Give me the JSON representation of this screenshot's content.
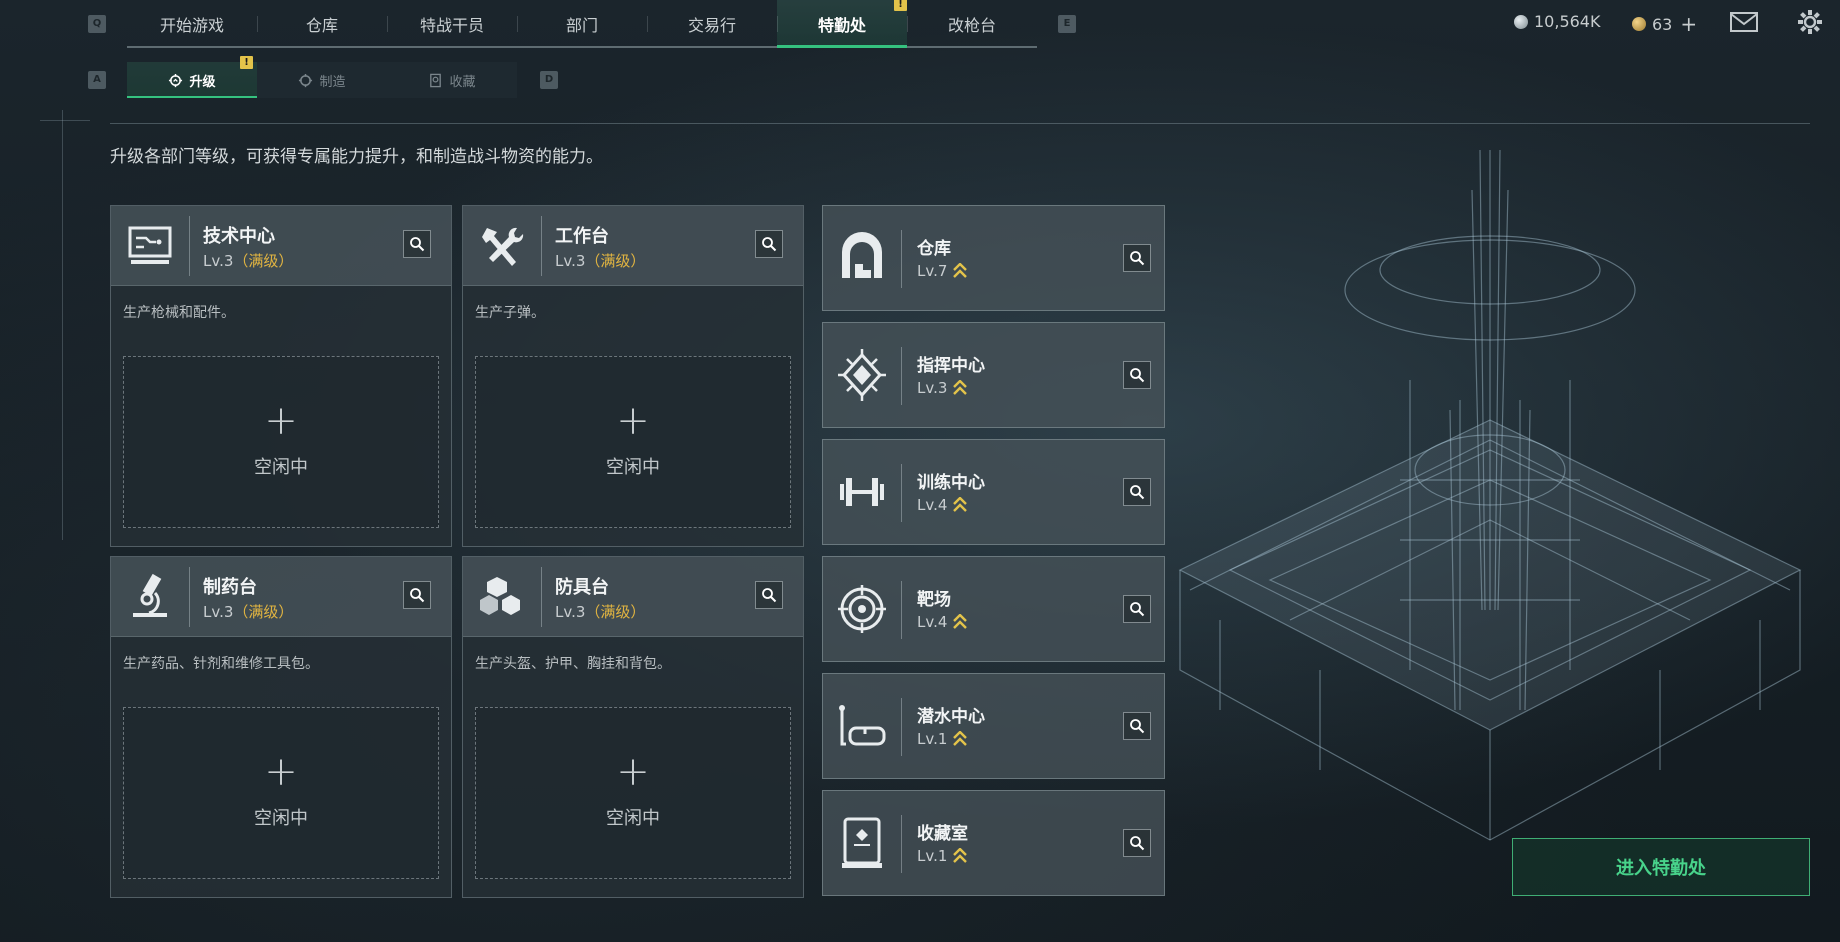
{
  "nav": {
    "key_left": "Q",
    "key_right": "E",
    "tabs": [
      {
        "label": "开始游戏"
      },
      {
        "label": "仓库"
      },
      {
        "label": "特战干员"
      },
      {
        "label": "部门"
      },
      {
        "label": "交易行"
      },
      {
        "label": "特勤处",
        "active": true,
        "alert": "!"
      },
      {
        "label": "改枪台"
      }
    ]
  },
  "subnav": {
    "key_left": "A",
    "key_right": "D",
    "tabs": [
      {
        "label": "升级",
        "active": true,
        "alert": "!"
      },
      {
        "label": "制造"
      },
      {
        "label": "收藏"
      }
    ]
  },
  "top_right": {
    "silver": "10,564K",
    "gold": "63",
    "gold_add": "+"
  },
  "description": "升级各部门等级，可获得专属能力提升，和制造战斗物资的能力。",
  "production_cards": [
    {
      "name": "技术中心",
      "level": "Lv.3",
      "maxed": "（满级）",
      "desc": "生产枪械和配件。",
      "plus": "+",
      "idle": "空闲中",
      "icon": "computer-icon"
    },
    {
      "name": "工作台",
      "level": "Lv.3",
      "maxed": "（满级）",
      "desc": "生产子弹。",
      "plus": "+",
      "idle": "空闲中",
      "icon": "hammer-wrench-icon"
    },
    {
      "name": "制药台",
      "level": "Lv.3",
      "maxed": "（满级）",
      "desc": "生产药品、针剂和维修工具包。",
      "plus": "+",
      "idle": "空闲中",
      "icon": "microscope-icon"
    },
    {
      "name": "防具台",
      "level": "Lv.3",
      "maxed": "（满级）",
      "desc": "生产头盔、护甲、胸挂和背包。",
      "plus": "+",
      "idle": "空闲中",
      "icon": "cubes-icon"
    }
  ],
  "facility_cards": [
    {
      "name": "仓库",
      "level": "Lv.7",
      "icon": "warehouse-icon"
    },
    {
      "name": "指挥中心",
      "level": "Lv.3",
      "icon": "command-icon"
    },
    {
      "name": "训练中心",
      "level": "Lv.4",
      "icon": "dumbbell-icon"
    },
    {
      "name": "靶场",
      "level": "Lv.4",
      "icon": "target-icon"
    },
    {
      "name": "潜水中心",
      "level": "Lv.1",
      "icon": "diving-mask-icon"
    },
    {
      "name": "收藏室",
      "level": "Lv.1",
      "icon": "display-case-icon"
    }
  ],
  "enter_button": "进入特勤处",
  "colors": {
    "accent_green": "#35c27f",
    "maxed_gold": "#e1b441",
    "upgrade_arrow": "#e3c34a",
    "alert_yellow": "#e3c34a"
  }
}
